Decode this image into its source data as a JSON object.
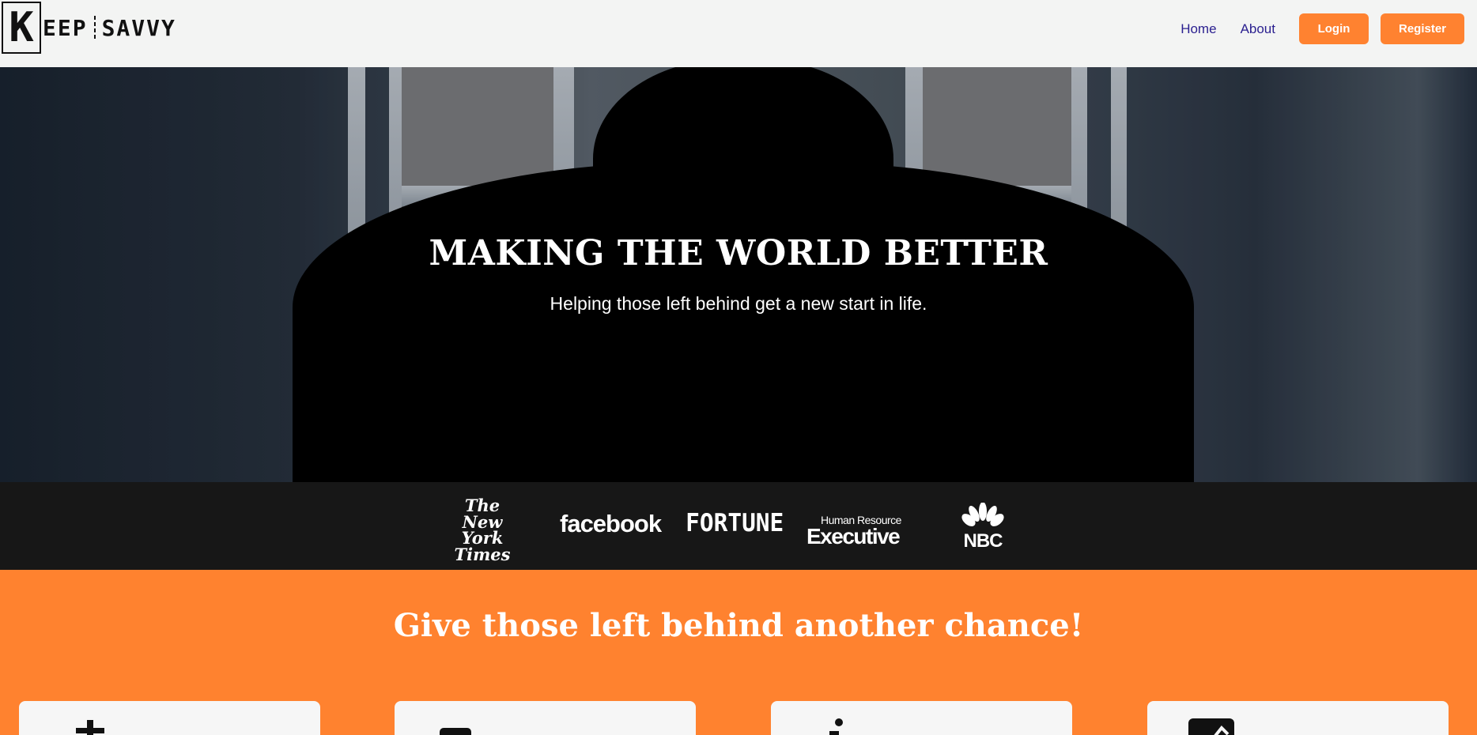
{
  "header": {
    "logo": {
      "initial": "K",
      "word1": "EEP",
      "word2": "SAVVY"
    },
    "nav": {
      "home": "Home",
      "about": "About",
      "login": "Login",
      "register": "Register"
    }
  },
  "hero": {
    "title": "MAKING THE WORLD BETTER",
    "subtitle": "Helping those left behind get a new start in life."
  },
  "press": {
    "logos": [
      {
        "name": "nyt-logo",
        "text": [
          "The",
          "New York",
          "Times"
        ]
      },
      {
        "name": "facebook-logo",
        "text": "facebook"
      },
      {
        "name": "fortune-logo",
        "text": "FORTUNE"
      },
      {
        "name": "hre-logo",
        "small": "Human Resource",
        "big": "Executive"
      },
      {
        "name": "nbc-logo",
        "text": "NBC"
      }
    ]
  },
  "cta": {
    "title": "Give those left behind another chance!",
    "cards": [
      {
        "icon": "plus-icon"
      },
      {
        "icon": "laptop-icon"
      },
      {
        "icon": "person-icon"
      },
      {
        "icon": "chart-icon"
      }
    ]
  },
  "colors": {
    "accent": "#ff822f",
    "nav_link": "#2a1f8f",
    "press_bg": "#171717",
    "header_bg": "#f3f4f3"
  }
}
